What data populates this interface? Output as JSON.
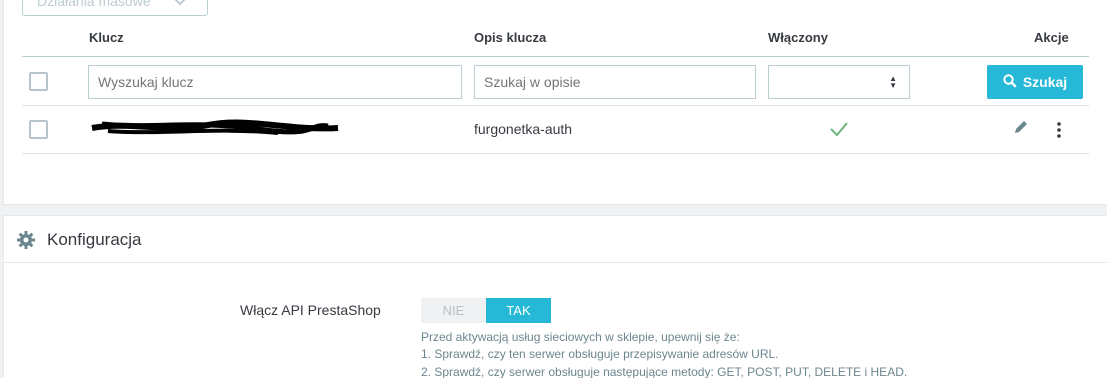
{
  "bulk_actions": {
    "label": "Działania masowe"
  },
  "table": {
    "columns": {
      "key": "Klucz",
      "description": "Opis klucza",
      "enabled": "Włączony",
      "actions": "Akcje"
    },
    "filters": {
      "key_placeholder": "Wyszukaj klucz",
      "description_placeholder": "Szukaj w opisie",
      "enabled_value": "",
      "search_label": "Szukaj"
    },
    "rows": [
      {
        "key": "",
        "description": "furgonetka-auth",
        "enabled": true
      }
    ]
  },
  "config": {
    "title": "Konfiguracja",
    "api_label": "Włącz API PrestaShop",
    "toggle": {
      "off": "NIE",
      "on": "TAK",
      "value": "TAK"
    },
    "help": [
      "Przed aktywacją usług sieciowych w sklepie, upewnij się że:",
      "1. Sprawdź, czy ten serwer obsługuje przepisywanie adresów URL.",
      "2. Sprawdź, czy serwer obsługuje następujące metody: GET, POST, PUT, DELETE i HEAD."
    ]
  },
  "colors": {
    "accent": "#25b9d7",
    "success": "#70b580",
    "border": "#bbcdd2"
  },
  "icons": {
    "search": "search-icon",
    "edit": "pencil-icon",
    "more": "dots-vertical-icon",
    "check": "check-icon",
    "settings": "gear-icon",
    "chevron": "chevron-down-icon"
  }
}
